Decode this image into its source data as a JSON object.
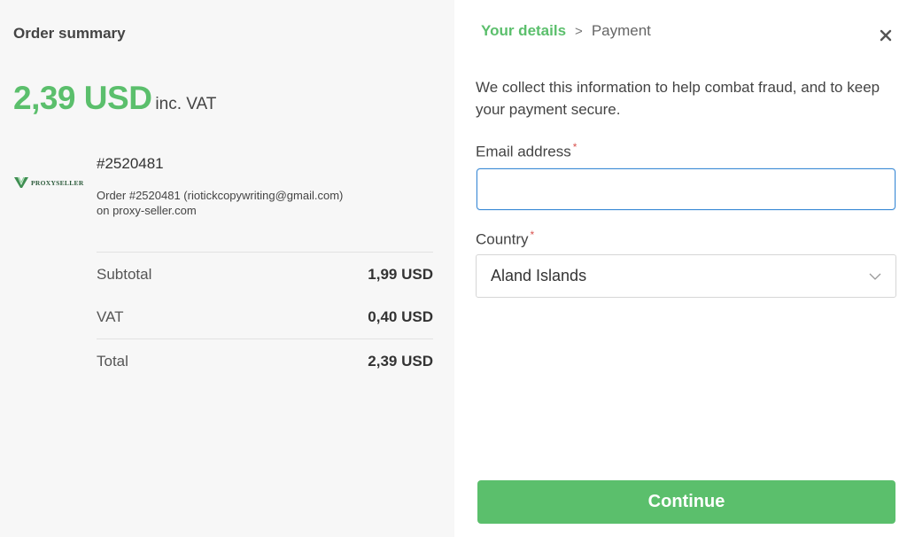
{
  "summary": {
    "title": "Order summary",
    "total_amount": "2,39 USD",
    "total_vat_note": "inc. VAT",
    "logo_text": "PROXYSELLER",
    "order_number": "#2520481",
    "order_desc_line1": "Order #2520481 (riotickcopywriting@gmail.com)",
    "order_desc_line2": "on proxy-seller.com",
    "lines": [
      {
        "label": "Subtotal",
        "value": "1,99 USD"
      },
      {
        "label": "VAT",
        "value": "0,40 USD"
      },
      {
        "label": "Total",
        "value": "2,39 USD"
      }
    ]
  },
  "checkout": {
    "breadcrumb": {
      "active": "Your details",
      "separator": ">",
      "next": "Payment"
    },
    "close_icon": "close-icon",
    "intro": "We collect this information to help combat fraud, and to keep your payment secure.",
    "email": {
      "label": "Email address",
      "required_mark": "*",
      "value": "",
      "placeholder": ""
    },
    "country": {
      "label": "Country",
      "required_mark": "*",
      "selected": "Aland Islands",
      "icon": "chevron-down-icon"
    },
    "continue_label": "Continue"
  },
  "colors": {
    "accent_green": "#5bbf6c",
    "focus_blue": "#3d8bd6",
    "required_red": "#d9534f",
    "left_panel_bg": "#f7f7f7"
  }
}
